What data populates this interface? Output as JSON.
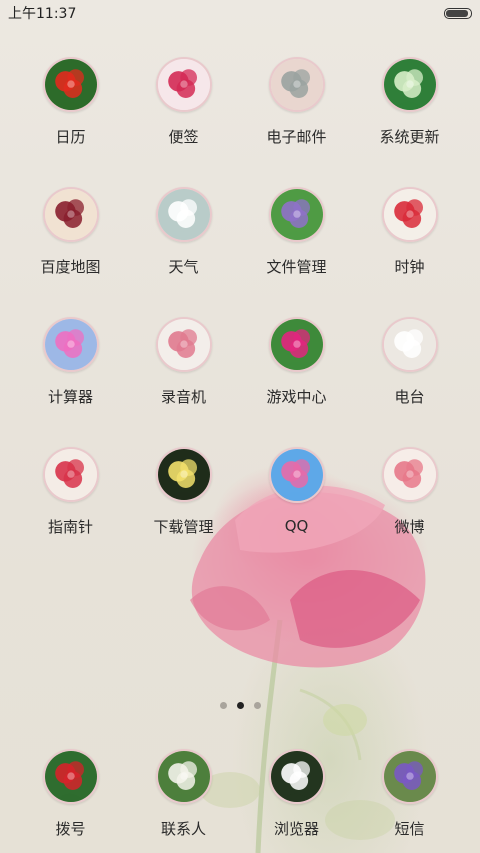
{
  "status_bar": {
    "time": "上午11:37",
    "battery_level": 0.9
  },
  "apps": [
    {
      "label": "日历",
      "icon": "red-rose-icon",
      "colors": [
        "#2d6b2a",
        "#e22a1d"
      ]
    },
    {
      "label": "便签",
      "icon": "pink-rose-icon",
      "colors": [
        "#f6e7ea",
        "#d42a55"
      ]
    },
    {
      "label": "电子邮件",
      "icon": "pale-flowers-icon",
      "colors": [
        "#e9d6cf",
        "#9aa3a0"
      ]
    },
    {
      "label": "系统更新",
      "icon": "green-buds-icon",
      "colors": [
        "#2f7f39",
        "#d8efc9"
      ]
    },
    {
      "label": "百度地图",
      "icon": "camellia-icon",
      "colors": [
        "#f1e2d2",
        "#8a1f2e"
      ]
    },
    {
      "label": "天气",
      "icon": "white-daisy-icon",
      "colors": [
        "#b9ccc9",
        "#ffffff"
      ]
    },
    {
      "label": "文件管理",
      "icon": "purple-iris-icon",
      "colors": [
        "#4f9b44",
        "#8f71c9"
      ]
    },
    {
      "label": "时钟",
      "icon": "red-peony-icon",
      "colors": [
        "#f4efe8",
        "#d92b3a"
      ]
    },
    {
      "label": "计算器",
      "icon": "pink-meadow-icon",
      "colors": [
        "#9db8e6",
        "#ef6fc1"
      ]
    },
    {
      "label": "录音机",
      "icon": "pink-tulip-icon",
      "colors": [
        "#f3eeea",
        "#e07a8f"
      ]
    },
    {
      "label": "游戏中心",
      "icon": "magenta-cosmos-icon",
      "colors": [
        "#3e8a3a",
        "#e3247f"
      ]
    },
    {
      "label": "电台",
      "icon": "white-rose-icon",
      "colors": [
        "#ece8e2",
        "#ffffff"
      ]
    },
    {
      "label": "指南针",
      "icon": "red-bloom-icon",
      "colors": [
        "#f4ece6",
        "#d8334a"
      ]
    },
    {
      "label": "下载管理",
      "icon": "yellow-lily-icon",
      "colors": [
        "#1f2c1a",
        "#f2e06c"
      ]
    },
    {
      "label": "QQ",
      "icon": "sky-cosmos-icon",
      "colors": [
        "#5ea8e8",
        "#e86aa8"
      ]
    },
    {
      "label": "微博",
      "icon": "pink-sketch-icon",
      "colors": [
        "#f6ede8",
        "#e7788a"
      ]
    }
  ],
  "page_indicator": {
    "pages": 3,
    "current": 2
  },
  "dock": [
    {
      "label": "拨号",
      "icon": "red-ixora-icon",
      "colors": [
        "#2f6d2f",
        "#d6222a"
      ]
    },
    {
      "label": "联系人",
      "icon": "white-lily-icon",
      "colors": [
        "#4d7f3c",
        "#f3f3ea"
      ]
    },
    {
      "label": "浏览器",
      "icon": "white-star-flower-icon",
      "colors": [
        "#23351f",
        "#ffffff"
      ]
    },
    {
      "label": "短信",
      "icon": "violet-flower-icon",
      "colors": [
        "#6a8a4c",
        "#7a58c4"
      ]
    }
  ]
}
